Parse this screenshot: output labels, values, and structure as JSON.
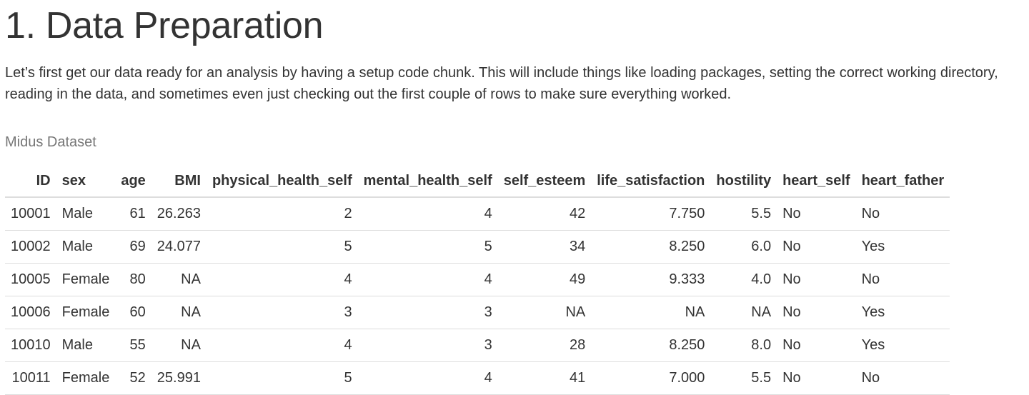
{
  "heading": "1. Data Preparation",
  "intro": "Let’s first get our data ready for an analysis by having a setup code chunk. This will include things like loading packages, setting the correct working directory, reading in the data, and sometimes even just checking out the first couple of rows to make sure everything worked.",
  "table": {
    "caption": "Midus Dataset",
    "columns": [
      "ID",
      "sex",
      "age",
      "BMI",
      "physical_health_self",
      "mental_health_self",
      "self_esteem",
      "life_satisfaction",
      "hostility",
      "heart_self",
      "heart_father"
    ],
    "align": [
      "r",
      "l",
      "r",
      "r",
      "r",
      "r",
      "r",
      "r",
      "r",
      "l",
      "l"
    ],
    "rows": [
      [
        "10001",
        "Male",
        "61",
        "26.263",
        "2",
        "4",
        "42",
        "7.750",
        "5.5",
        "No",
        "No"
      ],
      [
        "10002",
        "Male",
        "69",
        "24.077",
        "5",
        "5",
        "34",
        "8.250",
        "6.0",
        "No",
        "Yes"
      ],
      [
        "10005",
        "Female",
        "80",
        "NA",
        "4",
        "4",
        "49",
        "9.333",
        "4.0",
        "No",
        "No"
      ],
      [
        "10006",
        "Female",
        "60",
        "NA",
        "3",
        "3",
        "NA",
        "NA",
        "NA",
        "No",
        "Yes"
      ],
      [
        "10010",
        "Male",
        "55",
        "NA",
        "4",
        "3",
        "28",
        "8.250",
        "8.0",
        "No",
        "Yes"
      ],
      [
        "10011",
        "Female",
        "52",
        "25.991",
        "5",
        "4",
        "41",
        "7.000",
        "5.5",
        "No",
        "No"
      ]
    ]
  }
}
